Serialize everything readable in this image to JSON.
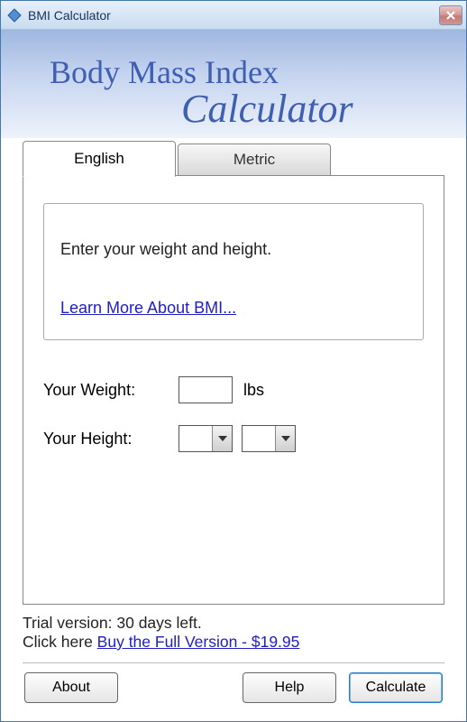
{
  "window": {
    "title": "BMI Calculator"
  },
  "banner": {
    "line1": "Body Mass Index",
    "line2": "Calculator"
  },
  "tabs": {
    "english": "English",
    "metric": "Metric",
    "active": "english"
  },
  "panel": {
    "prompt": "Enter your weight and height.",
    "learn_more": "Learn More About BMI...",
    "weight_label": "Your Weight:",
    "weight_value": "",
    "weight_unit": "lbs",
    "height_label": "Your Height:",
    "height_feet_value": "",
    "height_inches_value": ""
  },
  "trial": {
    "line1": "Trial version: 30 days left.",
    "line2_prefix": "Click here ",
    "buy_link": "Buy the Full Version - $19.95"
  },
  "footer": {
    "about": "About",
    "help": "Help",
    "calculate": "Calculate"
  }
}
